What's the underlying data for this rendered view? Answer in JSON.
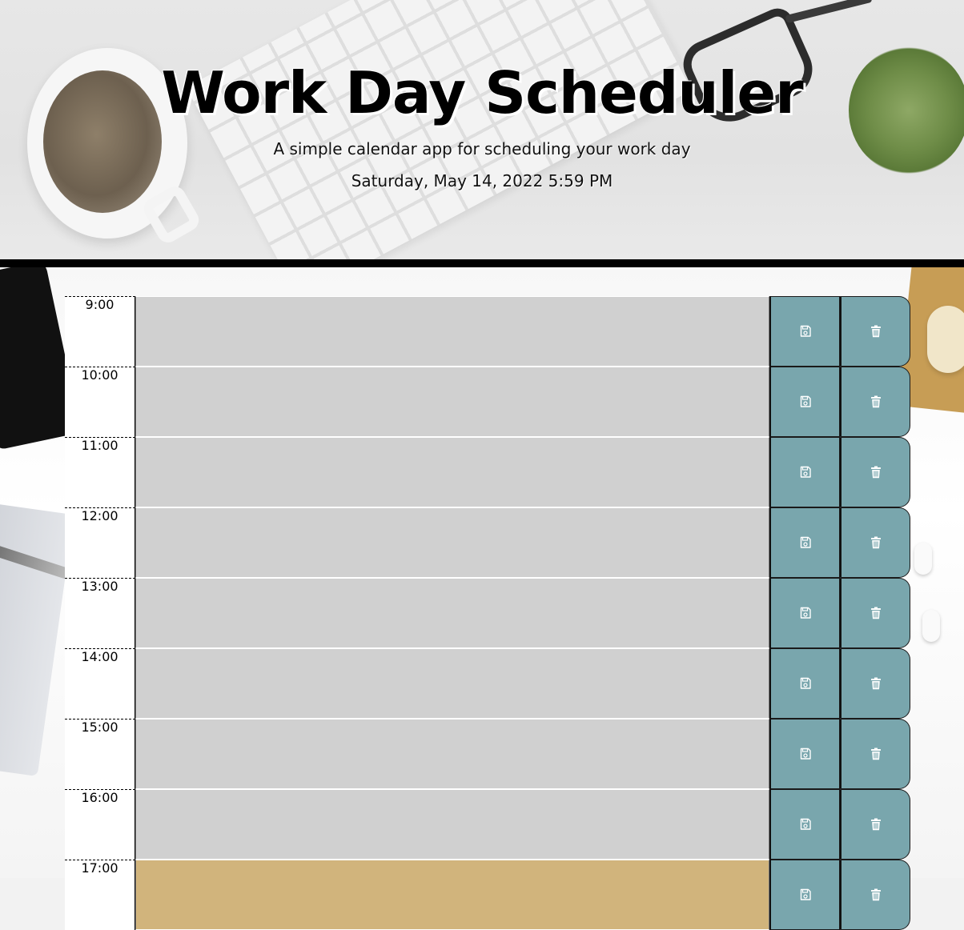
{
  "header": {
    "title": "Work Day Scheduler",
    "lead": "A simple calendar app for scheduling your work day",
    "current_day": "Saturday, May 14, 2022 5:59 PM"
  },
  "colors": {
    "past": "#d0d0d0",
    "present": "#d1b47c",
    "button": "#79a6ad"
  },
  "time_blocks": [
    {
      "hour": "9:00",
      "status": "past",
      "text": "",
      "save_icon": "floppy-disk-icon",
      "delete_icon": "trash-icon"
    },
    {
      "hour": "10:00",
      "status": "past",
      "text": "",
      "save_icon": "floppy-disk-icon",
      "delete_icon": "trash-icon"
    },
    {
      "hour": "11:00",
      "status": "past",
      "text": "",
      "save_icon": "floppy-disk-icon",
      "delete_icon": "trash-icon"
    },
    {
      "hour": "12:00",
      "status": "past",
      "text": "",
      "save_icon": "floppy-disk-icon",
      "delete_icon": "trash-icon"
    },
    {
      "hour": "13:00",
      "status": "past",
      "text": "",
      "save_icon": "floppy-disk-icon",
      "delete_icon": "trash-icon"
    },
    {
      "hour": "14:00",
      "status": "past",
      "text": "",
      "save_icon": "floppy-disk-icon",
      "delete_icon": "trash-icon"
    },
    {
      "hour": "15:00",
      "status": "past",
      "text": "",
      "save_icon": "floppy-disk-icon",
      "delete_icon": "trash-icon"
    },
    {
      "hour": "16:00",
      "status": "past",
      "text": "",
      "save_icon": "floppy-disk-icon",
      "delete_icon": "trash-icon"
    },
    {
      "hour": "17:00",
      "status": "present",
      "text": "",
      "save_icon": "floppy-disk-icon",
      "delete_icon": "trash-icon"
    }
  ]
}
